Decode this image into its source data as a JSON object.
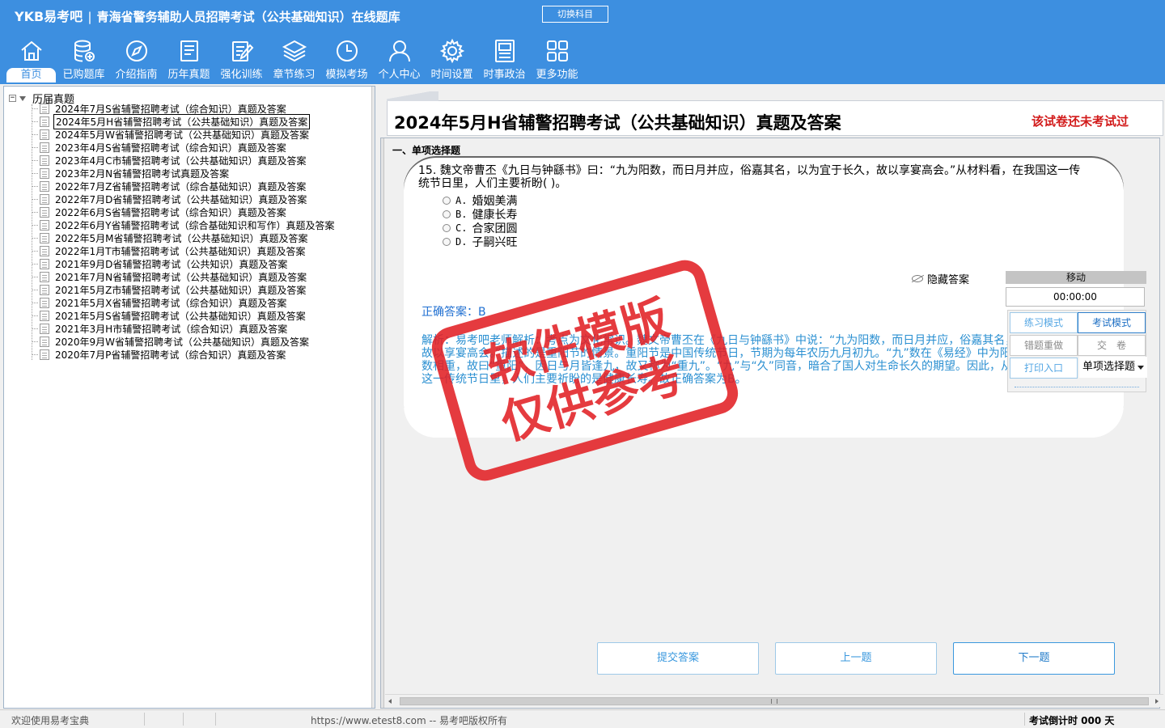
{
  "app": {
    "brand": "YKB易考吧",
    "separator": "|",
    "title": "青海省警务辅助人员招聘考试（公共基础知识）在线题库",
    "switch_label": "切换科目"
  },
  "nav": [
    {
      "label": "首页",
      "icon": "home-icon"
    },
    {
      "label": "已购题库",
      "icon": "database-icon"
    },
    {
      "label": "介绍指南",
      "icon": "compass-icon"
    },
    {
      "label": "历年真题",
      "icon": "list-icon"
    },
    {
      "label": "强化训练",
      "icon": "edit-icon"
    },
    {
      "label": "章节练习",
      "icon": "layers-icon"
    },
    {
      "label": "模拟考场",
      "icon": "clock-icon"
    },
    {
      "label": "个人中心",
      "icon": "user-icon"
    },
    {
      "label": "时间设置",
      "icon": "gear-icon"
    },
    {
      "label": "时事政治",
      "icon": "news-icon"
    },
    {
      "label": "更多功能",
      "icon": "grid-icon"
    }
  ],
  "tree": {
    "root_toggle": "−",
    "root_label": "历届真题",
    "selected_index": 1,
    "items": [
      "2024年7月S省辅警招聘考试（综合知识）真题及答案",
      "2024年5月H省辅警招聘考试（公共基础知识）真题及答案",
      "2024年5月W省辅警招聘考试（公共基础知识）真题及答案",
      "2023年4月S省辅警招聘考试（综合知识）真题及答案",
      "2023年4月C市辅警招聘考试（公共基础知识）真题及答案",
      "2023年2月N省辅警招聘考试真题及答案",
      "2022年7月Z省辅警招聘考试（综合基础知识）真题及答案",
      "2022年7月D省辅警招聘考试（公共基础知识）真题及答案",
      "2022年6月S省辅警招聘考试（综合知识）真题及答案",
      "2022年6月Y省辅警招聘考试（综合基础知识和写作）真题及答案",
      "2022年5月M省辅警招聘考试（公共基础知识）真题及答案",
      "2022年1月T市辅警招聘考试（公共基础知识）真题及答案",
      "2021年9月D省辅警招聘考试（公共知识）真题及答案",
      "2021年7月N省辅警招聘考试（公共基础知识）真题及答案",
      "2021年5月Z市辅警招聘考试（公共基础知识）真题及答案",
      "2021年5月X省辅警招聘考试（综合知识）真题及答案",
      "2021年5月S省辅警招聘考试（公共基础知识）真题及答案",
      "2021年3月H市辅警招聘考试（综合知识）真题及答案",
      "2020年9月W省辅警招聘考试（公共基础知识）真题及答案",
      "2020年7月P省辅警招聘考试（综合知识）真题及答案"
    ]
  },
  "exam": {
    "title": "2024年5月H省辅警招聘考试（公共基础知识）真题及答案",
    "status": "该试卷还未考试过",
    "section": "一、单项选择题",
    "question": "15. 魏文帝曹丕《九日与钟繇书》曰：“九为阳数，而日月并应，俗嘉其名，以为宜于长久，故以享宴高会。”从材料看，在我国这一传统节日里，人们主要祈盼(   )。",
    "options": [
      {
        "key": "A.",
        "text": "婚姻美满"
      },
      {
        "key": "B.",
        "text": "健康长寿"
      },
      {
        "key": "C.",
        "text": "合家团圆"
      },
      {
        "key": "D.",
        "text": "子嗣兴旺"
      }
    ],
    "hide_answer_label": "隐藏答案",
    "answer_label": "正确答案：",
    "answer_value": "B",
    "analysis": "解析：易考吧老师解析：考点为文化常识。魏文帝曹丕在《九日与钟繇书》中说：“九为阳数，而日月并应，俗嘉其名，以为宜于长久，故以享宴高会。”描述的是重阳节的情景。重阳节是中国传统节日，节期为每年农历九月初九。“九”数在《易经》中为阳数，“九九”两阳数相重，故曰“重阳”，因日与月皆逢九，故又称为“重九”。“九”与“久”同音，暗合了国人对生命长久的期望。因此，从材料看，在我国这一传统节日里，人们主要祈盼的是健康长寿。故正确答案为B。"
  },
  "tools": {
    "move_label": "移动",
    "timer": "00:00:00",
    "practice_mode": "练习模式",
    "exam_mode": "考试模式",
    "wrong_redo": "错题重做",
    "submit_paper": "交　卷",
    "print_entry": "打印入口",
    "question_type": "单项选择题"
  },
  "actions": {
    "submit": "提交答案",
    "prev": "上一题",
    "next": "下一题"
  },
  "statusbar": {
    "welcome": "欢迎使用易考宝典",
    "copyright": "https://www.etest8.com -- 易考吧版权所有",
    "countdown": "考试倒计时 000 天"
  },
  "watermark": {
    "line1": "软件模版",
    "line2": "仅供参考"
  },
  "colors": {
    "header_bg": "#3d8fe0",
    "status_red": "#d21a1a",
    "analysis_blue": "#2a8fd1",
    "stamp_red": "#e12024"
  }
}
